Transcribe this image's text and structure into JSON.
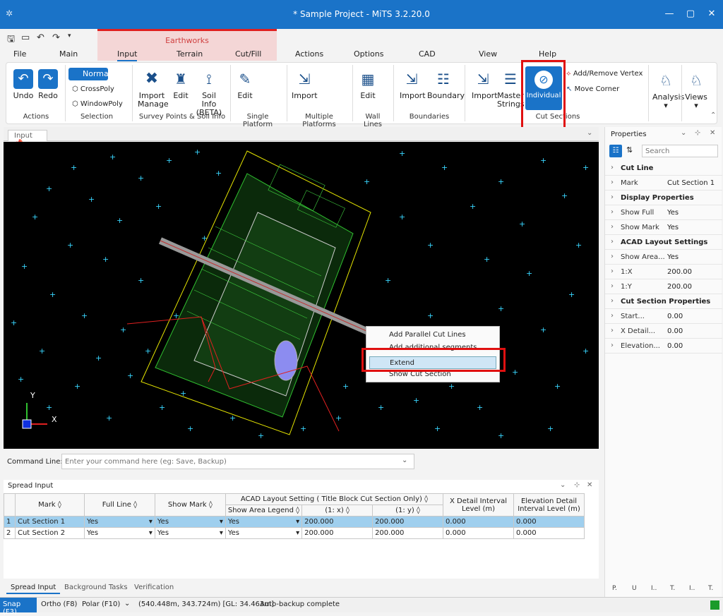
{
  "window": {
    "title": "* Sample Project - MiTS 3.2.20.0"
  },
  "tabs": {
    "file": "File",
    "main": "Main",
    "group": "Earthworks",
    "input": "Input",
    "terrain": "Terrain",
    "cutfill": "Cut/Fill",
    "actions": "Actions",
    "options": "Options",
    "cad": "CAD",
    "view": "View",
    "help": "Help"
  },
  "ribbon": {
    "undo": "Undo",
    "redo": "Redo",
    "actions_group": "Actions",
    "normal": "Normal",
    "crosspoly": "CrossPoly",
    "windowpoly": "WindowPoly",
    "selection_group": "Selection",
    "import": "Import",
    "manage": "Manage",
    "edit": "Edit",
    "soil_info": "Soil Info",
    "beta": "(BETA)",
    "survey_group": "Survey Points & Soil Info",
    "single_group": "Single Platform",
    "multiple_group": "Multiple Platforms",
    "wall_group": "Wall Lines",
    "boundary": "Boundary",
    "boundaries_group": "Boundaries",
    "master": "Master",
    "strings": "Strings",
    "individual": "Individual",
    "add_remove_vertex": "Add/Remove Vertex",
    "move_corner": "Move Corner",
    "cut_group": "Cut Sections",
    "analysis": "Analysis",
    "views": "Views"
  },
  "doc_tab": "Input",
  "context_menu": [
    "Add Parallel Cut Lines",
    "Add additional segments",
    "Extend",
    "Show Cut Section"
  ],
  "properties": {
    "title": "Properties",
    "search_placeholder": "Search",
    "rows": [
      {
        "k": "Cut Line",
        "v": "",
        "cat": true
      },
      {
        "k": "Mark",
        "v": "Cut Section 1"
      },
      {
        "k": "Display Properties",
        "v": "",
        "cat": true
      },
      {
        "k": "Show Full",
        "v": "Yes"
      },
      {
        "k": "Show Mark",
        "v": "Yes"
      },
      {
        "k": "ACAD Layout Settings",
        "v": "",
        "cat": true
      },
      {
        "k": "Show Area...",
        "v": "Yes"
      },
      {
        "k": "1:X",
        "v": "200.00"
      },
      {
        "k": "1:Y",
        "v": "200.00"
      },
      {
        "k": "Cut Section Properties",
        "v": "",
        "cat": true
      },
      {
        "k": "Start...",
        "v": "0.00"
      },
      {
        "k": "X Detail...",
        "v": "0.00"
      },
      {
        "k": "Elevation...",
        "v": "0.00"
      }
    ],
    "bottom_tabs": [
      "P.",
      "U",
      "I..",
      "T.",
      "I..",
      "T."
    ]
  },
  "command": {
    "label": "Command Line:",
    "placeholder": "Enter your command here (eg: Save, Backup)"
  },
  "spread": {
    "title": "Spread Input",
    "headers": [
      "Mark",
      "Full Line",
      "Show Mark",
      "ACAD Layout Setting ( Title Block Cut Section Only)",
      "Show Area Legend",
      "(1: x)",
      "(1: y)",
      "X Detail Interval Level (m)",
      "Elevation Detail Interval Level (m)"
    ],
    "rows": [
      {
        "n": "1",
        "mark": "Cut Section 1",
        "full": "Yes",
        "show": "Yes",
        "area": "Yes",
        "x": "200.000",
        "y": "200.000",
        "xd": "0.000",
        "ed": "0.000"
      },
      {
        "n": "2",
        "mark": "Cut Section 2",
        "full": "Yes",
        "show": "Yes",
        "area": "Yes",
        "x": "200.000",
        "y": "200.000",
        "xd": "0.000",
        "ed": "0.000"
      }
    ]
  },
  "bottom_tabs": [
    "Spread Input",
    "Background Tasks",
    "Verification"
  ],
  "status": {
    "snap": "Snap (F3)",
    "ortho": "Ortho (F8)",
    "polar": "Polar (F10)",
    "coords": "(540.448m, 343.724m) [GL: 34.463m]",
    "msg": "Auto-backup complete"
  },
  "colors": {
    "accent": "#1a73c8",
    "highlight": "#e01010"
  }
}
